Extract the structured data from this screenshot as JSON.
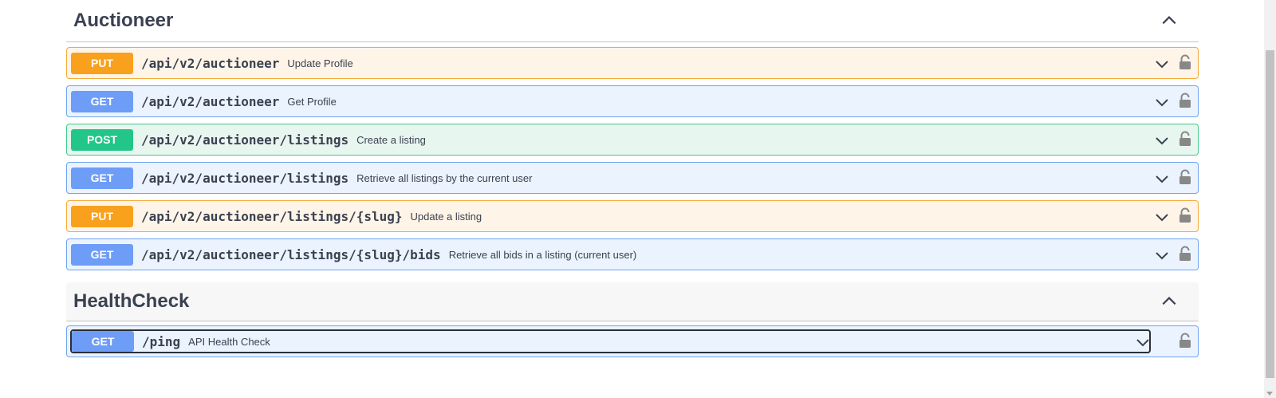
{
  "sections": [
    {
      "title": "Auctioneer",
      "operations": [
        {
          "method": "PUT",
          "path": "/api/v2/auctioneer",
          "summary": "Update Profile"
        },
        {
          "method": "GET",
          "path": "/api/v2/auctioneer",
          "summary": "Get Profile"
        },
        {
          "method": "POST",
          "path": "/api/v2/auctioneer/listings",
          "summary": "Create a listing"
        },
        {
          "method": "GET",
          "path": "/api/v2/auctioneer/listings",
          "summary": "Retrieve all listings by the current user"
        },
        {
          "method": "PUT",
          "path": "/api/v2/auctioneer/listings/{slug}",
          "summary": "Update a listing"
        },
        {
          "method": "GET",
          "path": "/api/v2/auctioneer/listings/{slug}/bids",
          "summary": "Retrieve all bids in a listing (current user)"
        }
      ]
    },
    {
      "title": "HealthCheck",
      "operations": [
        {
          "method": "GET",
          "path": "/ping",
          "summary": "API Health Check"
        }
      ]
    }
  ],
  "icons": {
    "section_toggle": "chevron-up-icon",
    "operation_toggle": "chevron-down-icon",
    "auth": "lock-icon"
  },
  "colors": {
    "get": "#6e9df7",
    "put": "#f9a11d",
    "post": "#21c688",
    "text": "#3b4151"
  }
}
